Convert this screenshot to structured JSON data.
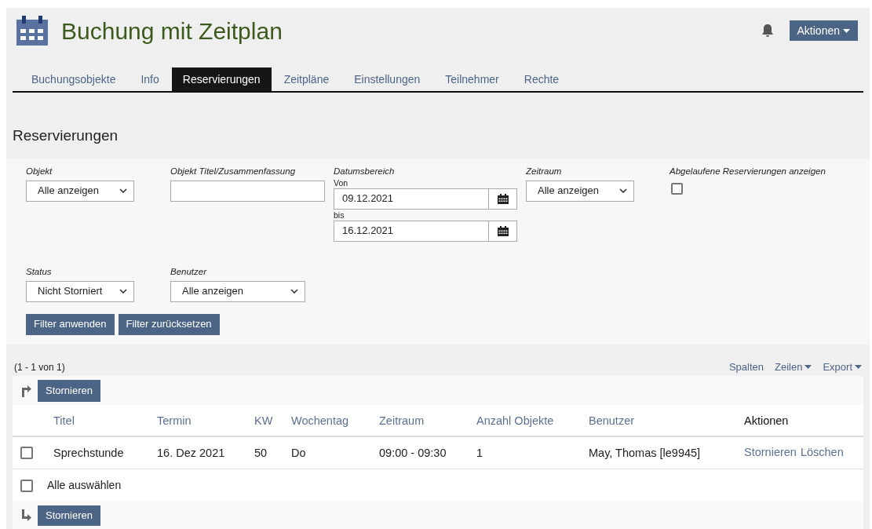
{
  "header": {
    "title": "Buchung mit Zeitplan",
    "actions_button": "Aktionen"
  },
  "tabs": [
    {
      "label": "Buchungsobjekte",
      "selected": false
    },
    {
      "label": "Info",
      "selected": false
    },
    {
      "label": "Reservierungen",
      "selected": true
    },
    {
      "label": "Zeitpläne",
      "selected": false
    },
    {
      "label": "Einstellungen",
      "selected": false
    },
    {
      "label": "Teilnehmer",
      "selected": false
    },
    {
      "label": "Rechte",
      "selected": false
    }
  ],
  "section_title": "Reservierungen",
  "filter_rows": [
    [
      {
        "kind": "select",
        "label": "Objekt",
        "value": "Alle anzeigen"
      },
      {
        "kind": "text",
        "label": "Objekt Titel/Zusammenfassung"
      },
      {
        "kind": "daterange",
        "label": "Datumsbereich",
        "from_label": "Von",
        "from": "09.12.2021",
        "to_label": "bis",
        "to": "16.12.2021"
      },
      {
        "kind": "select",
        "label": "Zeitraum",
        "value": "Alle anzeigen"
      },
      {
        "kind": "checkbox",
        "label": "Abgelaufene Reservierungen anzeigen",
        "checked": false
      }
    ],
    [
      {
        "kind": "select",
        "label": "Status",
        "value": "Nicht Storniert"
      },
      {
        "kind": "select",
        "label": "Benutzer",
        "value": "Alle anzeigen"
      }
    ]
  ],
  "filter_buttons": [
    "Filter anwenden",
    "Filter zurücksetzen"
  ],
  "table": {
    "count": "(1 - 1 von 1)",
    "view_links": [
      {
        "label": "Spalten",
        "dropdown": false
      },
      {
        "label": "Zeilen",
        "dropdown": true
      },
      {
        "label": "Export",
        "dropdown": true
      }
    ],
    "top_button": "Stornieren",
    "columns": [
      {
        "label": "Titel",
        "sortable": true
      },
      {
        "label": "Termin",
        "sortable": true
      },
      {
        "label": "KW",
        "sortable": true
      },
      {
        "label": "Wochentag",
        "sortable": true
      },
      {
        "label": "Zeitraum",
        "sortable": true
      },
      {
        "label": "Anzahl Objekte",
        "sortable": true
      },
      {
        "label": "Benutzer",
        "sortable": true
      },
      {
        "label": "Aktionen",
        "sortable": false
      }
    ],
    "rows": [
      {
        "checked": false,
        "cells": [
          "Sprechstunde",
          "16. Dez 2021",
          "50",
          "Do",
          "09:00 - 09:30",
          "1",
          "May, Thomas [le9945]"
        ],
        "actions": [
          "Stornieren",
          "Löschen"
        ]
      }
    ],
    "select_all": {
      "label": "Alle auswählen",
      "checked": false
    },
    "bottom_button": "Stornieren"
  }
}
